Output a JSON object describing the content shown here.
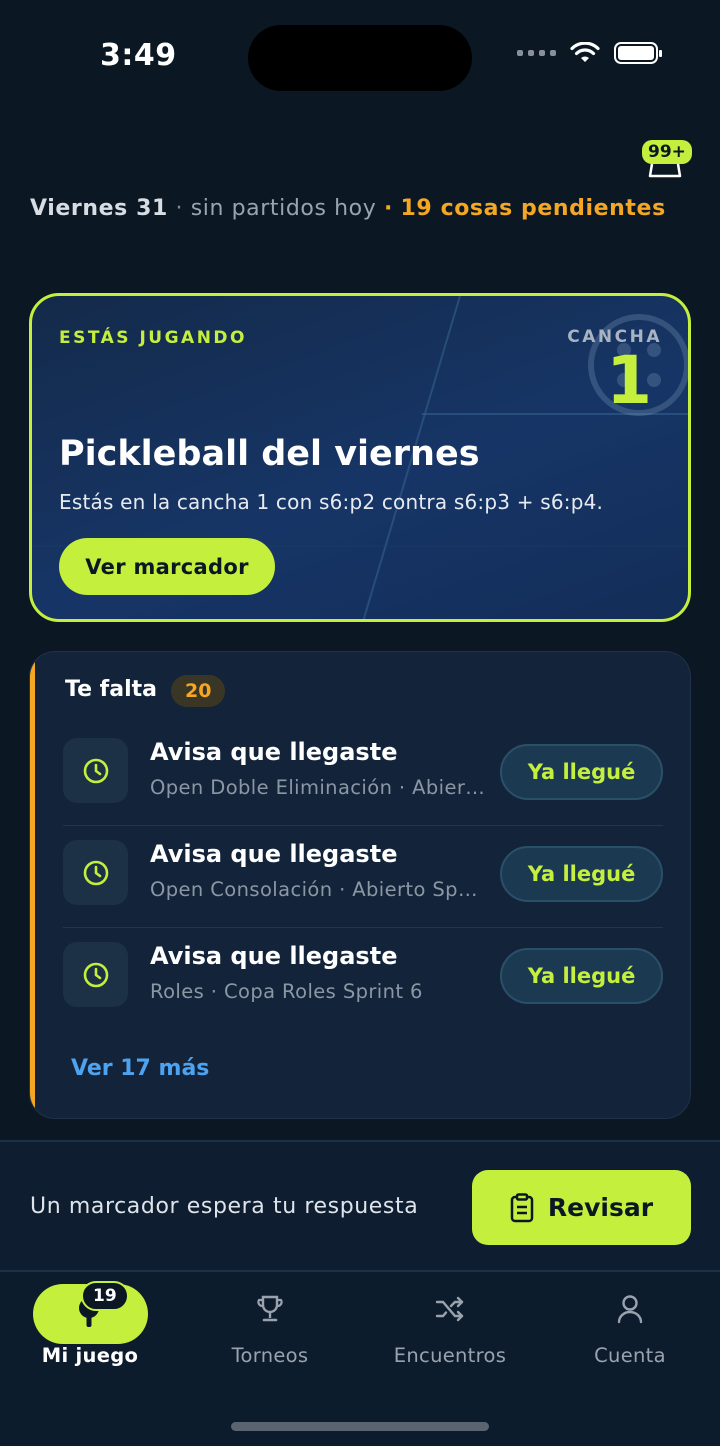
{
  "status_bar": {
    "time": "3:49"
  },
  "notifications": {
    "badge": "99+"
  },
  "date_line": {
    "day": "Viernes 31",
    "separator": "·",
    "no_matches": "sin partidos hoy",
    "pending": "19 cosas pendientes"
  },
  "playing": {
    "label": "ESTÁS JUGANDO",
    "court_label": "CANCHA",
    "court_number": "1",
    "title": "Pickleball del viernes",
    "subtitle": "Estás en la cancha 1 con s6:p2 contra s6:p3 + s6:p4.",
    "button": "Ver marcador"
  },
  "todo": {
    "title": "Te falta",
    "count": "20",
    "items": [
      {
        "title": "Avisa que llegaste",
        "subtitle": "Open Doble Eliminación · Abierto",
        "button": "Ya llegué"
      },
      {
        "title": "Avisa que llegaste",
        "subtitle": "Open Consolación · Abierto Sprint",
        "button": "Ya llegué"
      },
      {
        "title": "Avisa que llegaste",
        "subtitle": "Roles · Copa Roles Sprint 6",
        "button": "Ya llegué"
      }
    ],
    "more": "Ver 17 más"
  },
  "review": {
    "text": "Un marcador espera tu respuesta",
    "button": "Revisar"
  },
  "tabs": [
    {
      "label": "Mi juego",
      "icon": "pickleball-paddle-icon",
      "badge": "19",
      "active": true
    },
    {
      "label": "Torneos",
      "icon": "trophy-icon"
    },
    {
      "label": "Encuentros",
      "icon": "shuffle-icon"
    },
    {
      "label": "Cuenta",
      "icon": "person-icon"
    }
  ],
  "colors": {
    "accent": "#c4ef3d",
    "warning": "#f5a623",
    "link": "#4ea3f0",
    "background": "#0b1824"
  }
}
